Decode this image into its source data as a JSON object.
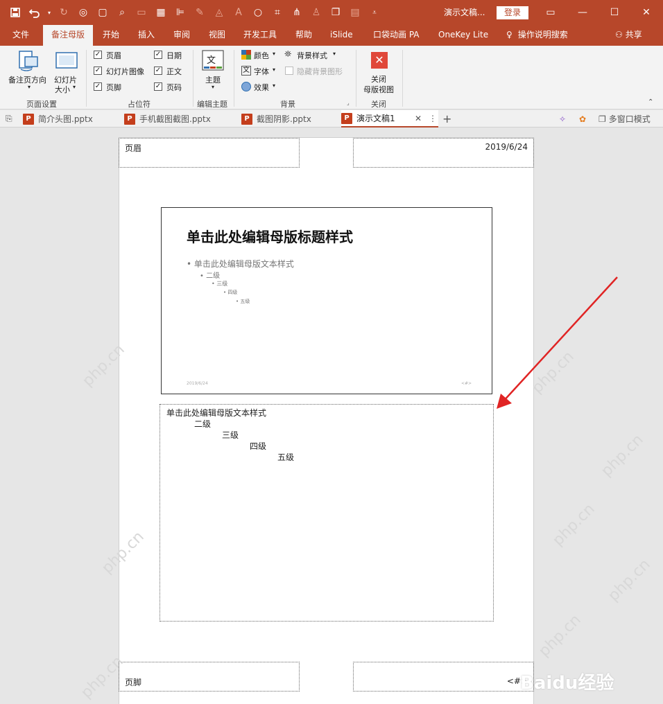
{
  "titlebar": {
    "doc_title": "演示文稿...",
    "login_label": "登录",
    "qat": {
      "save": "save-icon",
      "undo": "undo-icon",
      "redo": "redo-icon",
      "customize": "dropdown-icon"
    }
  },
  "menu": {
    "tabs": [
      "文件",
      "备注母版",
      "开始",
      "插入",
      "审阅",
      "视图",
      "开发工具",
      "帮助",
      "iSlide",
      "口袋动画 PA",
      "OneKey Lite",
      "操作说明搜索",
      "共享"
    ],
    "active_tab": "备注母版"
  },
  "ribbon": {
    "page_setup": {
      "notes_orientation": "备注页方向",
      "slide_size_1": "幻灯片",
      "slide_size_2": "大小",
      "label": "页面设置"
    },
    "placeholders": {
      "header": "页眉",
      "slide_image": "幻灯片图像",
      "footer": "页脚",
      "date": "日期",
      "body": "正文",
      "page_number": "页码",
      "label": "占位符"
    },
    "edit_theme": {
      "theme": "主题",
      "label": "编辑主题"
    },
    "background": {
      "colors": "颜色",
      "fonts": "字体",
      "effects": "效果",
      "bg_styles": "背景样式",
      "hide_bg": "隐藏背景图形",
      "label": "背景"
    },
    "close": {
      "close_1": "关闭",
      "close_2": "母版视图",
      "label": "关闭"
    }
  },
  "doc_tabs": [
    "简介头图.pptx",
    "手机截图截图.pptx",
    "截图阴影.pptx",
    "演示文稿1"
  ],
  "doc_tab_active": "演示文稿1",
  "doc_bar_right": "多窗口模式",
  "page": {
    "header": "页眉",
    "date": "2019/6/24",
    "footer": "页脚",
    "page_num": "<#>",
    "slide_title": "单击此处编辑母版标题样式",
    "slide_levels": [
      "单击此处编辑母版文本样式",
      "二级",
      "三级",
      "四级",
      "五级"
    ],
    "slide_footer_date": "2019/6/24",
    "notes_levels": [
      "单击此处编辑母版文本样式",
      "二级",
      "三级",
      "四级",
      "五级"
    ]
  },
  "watermark": {
    "text": "php.cn",
    "logo": "Baidu经验"
  },
  "colors": {
    "accent": "#b7472a",
    "arrow": "#e02424"
  }
}
